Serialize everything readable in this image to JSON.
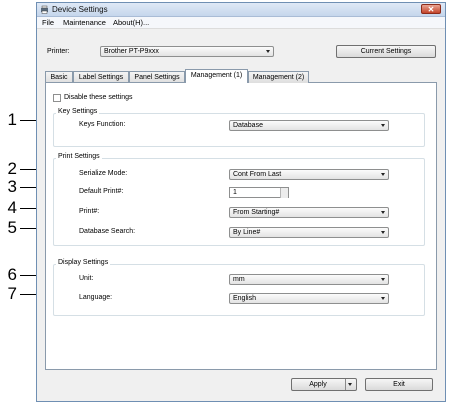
{
  "window": {
    "title": "Device Settings",
    "close_glyph": "✕"
  },
  "menu": [
    "File",
    "Maintenance",
    "About(H)..."
  ],
  "printer": {
    "label": "Printer:",
    "value": "Brother PT-P9xxx",
    "current_settings_button": "Current Settings"
  },
  "tabs": [
    "Basic",
    "Label Settings",
    "Panel Settings",
    "Management (1)",
    "Management (2)"
  ],
  "active_tab": "Management (1)",
  "disable_settings": {
    "label": "Disable these settings",
    "checked": false
  },
  "key_settings": {
    "title": "Key Settings",
    "keys_function": {
      "label": "Keys Function:",
      "value": "Database"
    }
  },
  "print_settings": {
    "title": "Print Settings",
    "serialize_mode": {
      "label": "Serialize Mode:",
      "value": "Cont From Last"
    },
    "default_print": {
      "label": "Default Print#:",
      "value": "1"
    },
    "print_num": {
      "label": "Print#:",
      "value": "From Starting#"
    },
    "database_search": {
      "label": "Database Search:",
      "value": "By Line#"
    }
  },
  "display_settings": {
    "title": "Display Settings",
    "unit": {
      "label": "Unit:",
      "value": "mm"
    },
    "language": {
      "label": "Language:",
      "value": "English"
    }
  },
  "buttons": {
    "apply": "Apply",
    "exit": "Exit"
  },
  "callouts": [
    "1",
    "2",
    "3",
    "4",
    "5",
    "6",
    "7"
  ],
  "colors": {
    "titlebar": "#c5d6ec",
    "close": "#c3442b",
    "panel": "#ffffff",
    "window": "#f0f0f0"
  }
}
